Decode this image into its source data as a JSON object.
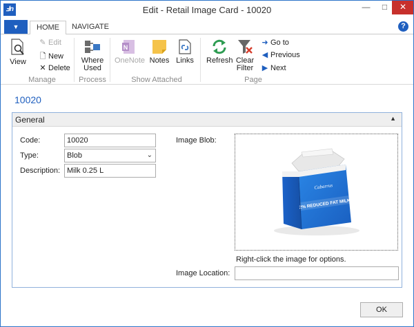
{
  "window": {
    "title": "Edit - Retail Image Card - 10020",
    "logo_text": "Ⅎn",
    "minimize": "—",
    "maximize": "□",
    "close": "✕"
  },
  "ribbon": {
    "file_button": "▼",
    "tabs": [
      {
        "label": "HOME"
      },
      {
        "label": "NAVIGATE"
      }
    ],
    "help": "?",
    "manage": {
      "label": "Manage",
      "view": "View",
      "edit": "Edit",
      "new": "New",
      "delete": "Delete"
    },
    "process": {
      "label": "Process",
      "where_used_line1": "Where",
      "where_used_line2": "Used"
    },
    "show_attached": {
      "label": "Show Attached",
      "onenote": "OneNote",
      "notes": "Notes",
      "links": "Links"
    },
    "page": {
      "label": "Page",
      "refresh": "Refresh",
      "clear_filter_line1": "Clear",
      "clear_filter_line2": "Filter",
      "go_to": "Go to",
      "previous": "Previous",
      "next": "Next"
    }
  },
  "page_title": "10020",
  "general": {
    "title": "General",
    "code_label": "Code:",
    "code_value": "10020",
    "type_label": "Type:",
    "type_value": "Blob",
    "description_label": "Description:",
    "description_value": "Milk 0.25 L",
    "image_blob_label": "Image Blob:",
    "image_product_text": "2% REDUCED FAT MILK",
    "image_hint": "Right-click the image for options.",
    "image_location_label": "Image Location:",
    "image_location_value": ""
  },
  "footer": {
    "ok": "OK"
  }
}
